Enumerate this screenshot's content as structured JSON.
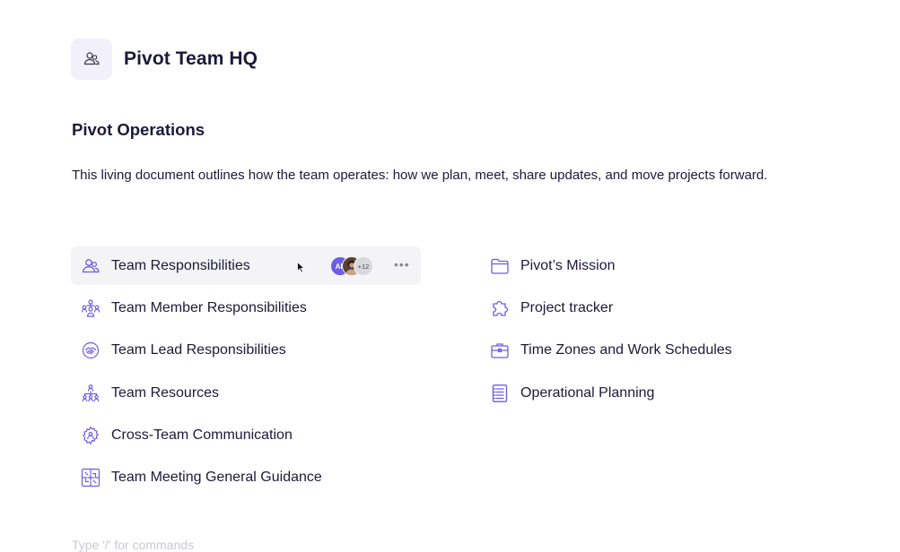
{
  "header": {
    "title": "Pivot Team HQ",
    "icon": "people-icon"
  },
  "section": {
    "title": "Pivot Operations",
    "description": "This living document outlines how the team operates: how we plan, meet, share updates, and move projects forward."
  },
  "left_items": [
    {
      "label": "Team Responsibilities",
      "icon": "people-icon"
    },
    {
      "label": "Team Member Responsibilities",
      "icon": "team-tree-icon"
    },
    {
      "label": "Team Lead Responsibilities",
      "icon": "handshake-icon"
    },
    {
      "label": "Team Resources",
      "icon": "hierarchy-icon"
    },
    {
      "label": "Cross-Team Communication",
      "icon": "gear-icon"
    },
    {
      "label": "Team Meeting General Guidance",
      "icon": "flowchart-icon"
    }
  ],
  "right_items": [
    {
      "label": "Pivot’s Mission",
      "icon": "folder-icon"
    },
    {
      "label": "Project tracker",
      "icon": "puzzle-icon"
    },
    {
      "label": "Time Zones and Work Schedules",
      "icon": "briefcase-icon"
    },
    {
      "label": "Operational Planning",
      "icon": "notebook-icon"
    }
  ],
  "hover_row": {
    "avatar_initials": "AL",
    "avatar_more_count": "+12"
  },
  "footer_hint": "Type '/' for commands",
  "colors": {
    "accent": "#6c5ce7",
    "text": "#1c1a3a",
    "hover_bg": "#f4f4f6",
    "icon_bg": "#f2f0fb"
  }
}
